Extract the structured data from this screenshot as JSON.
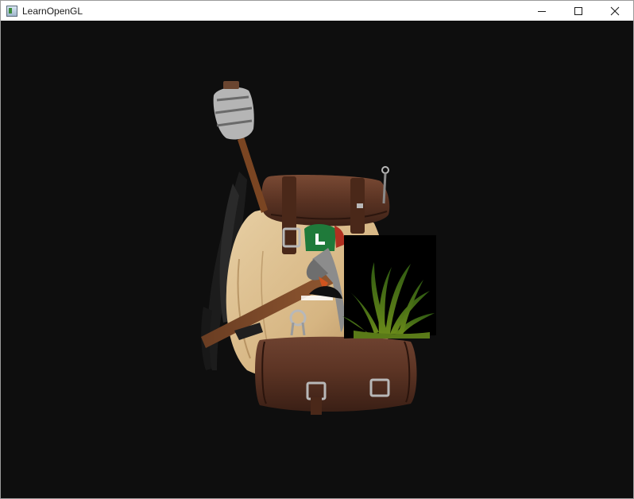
{
  "window": {
    "title": "LearnOpenGL",
    "icon": "app-window-icon",
    "controls": [
      "minimize-icon",
      "maximize-icon",
      "close-icon"
    ]
  },
  "scene": {
    "background_color": "#0e0e0e",
    "objects": [
      "backpack-model",
      "grass-quad"
    ]
  }
}
